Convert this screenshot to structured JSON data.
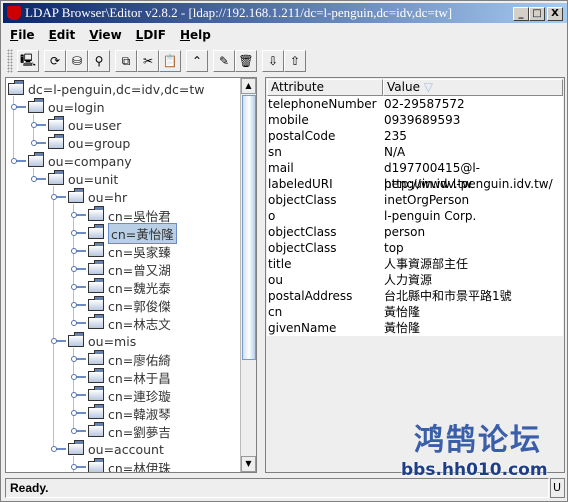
{
  "window": {
    "title": "LDAP Browser\\Editor v2.8.2 - [ldap://192.168.1.211/dc=l-penguin,dc=idv,dc=tw]",
    "buttons": [
      "_",
      "□",
      "X"
    ]
  },
  "menu": [
    "File",
    "Edit",
    "View",
    "LDIF",
    "Help"
  ],
  "toolbar": [
    {
      "icon": "connect-icon",
      "glyph": "🖳"
    },
    {
      "icon": "refresh-icon",
      "glyph": "⟳"
    },
    {
      "icon": "reconnect-icon",
      "glyph": "⛁"
    },
    {
      "icon": "search-binoculars-icon",
      "glyph": "⚲"
    },
    {
      "icon": "copy-icon",
      "glyph": "⧉"
    },
    {
      "icon": "cut-icon",
      "glyph": "✂"
    },
    {
      "icon": "paste-icon",
      "glyph": "📋"
    },
    {
      "icon": "up-icon",
      "glyph": "⌃"
    },
    {
      "icon": "edit-icon",
      "glyph": "✎"
    },
    {
      "icon": "delete-icon",
      "glyph": "🗑"
    },
    {
      "icon": "import-icon",
      "glyph": "⇩"
    },
    {
      "icon": "export-icon",
      "glyph": "⇧"
    }
  ],
  "tree": [
    {
      "label": "dc=l-penguin,dc=idv,dc=tw",
      "depth": 0
    },
    {
      "label": "ou=login",
      "depth": 1
    },
    {
      "label": "ou=user",
      "depth": 2
    },
    {
      "label": "ou=group",
      "depth": 2
    },
    {
      "label": "ou=company",
      "depth": 1
    },
    {
      "label": "ou=unit",
      "depth": 2
    },
    {
      "label": "ou=hr",
      "depth": 3
    },
    {
      "label": "cn=吳怡君",
      "depth": 4
    },
    {
      "label": "cn=黃怡隆",
      "depth": 4,
      "selected": true
    },
    {
      "label": "cn=吳家臻",
      "depth": 4
    },
    {
      "label": "cn=曾又湖",
      "depth": 4
    },
    {
      "label": "cn=魏光泰",
      "depth": 4
    },
    {
      "label": "cn=郭俊傑",
      "depth": 4
    },
    {
      "label": "cn=林志文",
      "depth": 4
    },
    {
      "label": "ou=mis",
      "depth": 3
    },
    {
      "label": "cn=廖佑綺",
      "depth": 4
    },
    {
      "label": "cn=林于昌",
      "depth": 4
    },
    {
      "label": "cn=連珍璇",
      "depth": 4
    },
    {
      "label": "cn=韓淑琴",
      "depth": 4
    },
    {
      "label": "cn=劉夢吉",
      "depth": 4
    },
    {
      "label": "ou=account",
      "depth": 3
    },
    {
      "label": "cn=林伊珠",
      "depth": 4
    }
  ],
  "table": {
    "columns": [
      "Attribute",
      "Value"
    ],
    "rows": [
      [
        "telephoneNumber",
        "02-29587572"
      ],
      [
        "mobile",
        "0939689593"
      ],
      [
        "postalCode",
        "235"
      ],
      [
        "sn",
        "N/A"
      ],
      [
        "mail",
        "d197700415@l-penguin.idv.tw"
      ],
      [
        "labeledURI",
        "http://www.l-penguin.idv.tw/"
      ],
      [
        "objectClass",
        "inetOrgPerson"
      ],
      [
        "o",
        "l-penguin Corp."
      ],
      [
        "objectClass",
        "person"
      ],
      [
        "objectClass",
        "top"
      ],
      [
        "title",
        "人事資源部主任"
      ],
      [
        "ou",
        "人力資源"
      ],
      [
        "postalAddress",
        "台北縣中和市景平路1號"
      ],
      [
        "cn",
        "黃怡隆"
      ],
      [
        "givenName",
        "黃怡隆"
      ]
    ]
  },
  "status": {
    "text": "Ready.",
    "right": "U"
  },
  "watermark": {
    "title": "鸿鹄论坛",
    "url": "bbs.hh010.com"
  }
}
